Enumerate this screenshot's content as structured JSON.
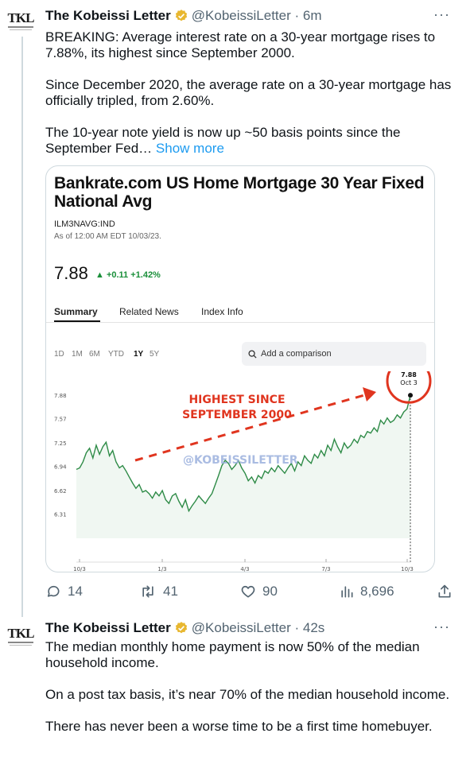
{
  "tweets": [
    {
      "author": "The Kobeissi Letter",
      "handle": "@KobeissiLetter",
      "time": "6m",
      "avatar_text": "TKL",
      "paragraphs": [
        "BREAKING: Average interest rate on a 30-year mortgage rises to 7.88%, its highest since September 2000.",
        "Since December 2020, the average rate on a 30-year mortgage has officially tripled, from 2.60%.",
        "The 10-year note yield is now up ~50 basis points since the September Fed…"
      ],
      "show_more": "Show more",
      "card": {
        "title": "Bankrate.com US Home Mortgage 30 Year Fixed National Avg",
        "ticker": "ILM3NAVG:IND",
        "as_of": "As of 12:00 AM EDT 10/03/23.",
        "price": "7.88",
        "change": "▲ +0.11 +1.42%",
        "tabs": [
          "Summary",
          "Related News",
          "Index Info"
        ],
        "ranges": [
          "1D",
          "1M",
          "6M",
          "YTD",
          "1Y",
          "5Y"
        ],
        "active_range": "1Y",
        "compare_placeholder": "Add a comparison"
      },
      "stats": {
        "replies": "14",
        "reposts": "41",
        "likes": "90",
        "views": "8,696"
      }
    },
    {
      "author": "The Kobeissi Letter",
      "handle": "@KobeissiLetter",
      "time": "42s",
      "avatar_text": "TKL",
      "paragraphs": [
        "The median monthly home payment is now 50% of the median household income.",
        "On a post tax basis, it’s near 70% of the median household income.",
        "There has never been a worse time to be a first time homebuyer."
      ]
    }
  ],
  "chart_data": {
    "type": "line",
    "y_ticks": [
      "7.88",
      "7.57",
      "7.25",
      "6.94",
      "6.62",
      "6.31"
    ],
    "x_ticks": [
      "10/3",
      "1/3",
      "4/3",
      "7/3",
      "10/3"
    ],
    "ylim": [
      6.2,
      8.05
    ],
    "annotation": "HIGHEST SINCE SEPTEMBER 2000",
    "callout_value": "7.88",
    "callout_date": "Oct 3",
    "watermark": "@KOBEISSILETTER",
    "line_color": "#2e8b47",
    "annotation_color": "#e0351f",
    "series": [
      {
        "values": [
          6.9,
          6.92,
          7.0,
          7.12,
          7.18,
          7.05,
          7.22,
          7.1,
          7.2,
          7.26,
          7.08,
          7.15,
          7.0,
          6.92,
          6.95,
          6.88,
          6.8,
          6.72,
          6.65,
          6.7,
          6.6,
          6.62,
          6.58,
          6.52,
          6.6,
          6.55,
          6.62,
          6.5,
          6.45,
          6.55,
          6.58,
          6.48,
          6.4,
          6.5,
          6.35,
          6.42,
          6.48,
          6.55,
          6.5,
          6.45,
          6.52,
          6.58,
          6.7,
          6.82,
          6.95,
          7.02,
          6.98,
          6.9,
          6.95,
          7.02,
          6.92,
          6.85,
          6.75,
          6.8,
          6.72,
          6.82,
          6.78,
          6.88,
          6.85,
          6.92,
          6.87,
          6.95,
          6.9,
          6.85,
          6.92,
          6.98,
          6.88,
          7.0,
          6.95,
          7.08,
          7.02,
          6.98,
          7.1,
          7.05,
          7.15,
          7.08,
          7.22,
          7.15,
          7.3,
          7.2,
          7.12,
          7.25,
          7.18,
          7.22,
          7.3,
          7.25,
          7.35,
          7.32,
          7.4,
          7.38,
          7.45,
          7.4,
          7.55,
          7.5,
          7.58,
          7.52,
          7.55,
          7.62,
          7.58,
          7.66,
          7.7,
          7.88
        ]
      }
    ]
  }
}
